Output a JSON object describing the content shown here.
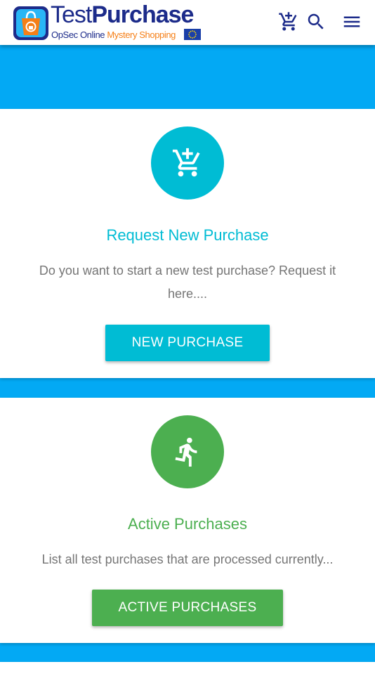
{
  "header": {
    "logo_title_thin": "Test",
    "logo_title_bold": "Purchase",
    "logo_sub_a": "OpSec Online ",
    "logo_sub_b": "Mystery Shopping",
    "icons": [
      "add-cart-icon",
      "search-icon",
      "menu-icon"
    ]
  },
  "cards": [
    {
      "icon": "add-shopping-cart-icon",
      "title": "Request New Purchase",
      "description": "Do you want to start a new test purchase? Request it here....",
      "button_label": "NEW PURCHASE",
      "color": "#00bcd4"
    },
    {
      "icon": "running-person-icon",
      "title": "Active Purchases",
      "description": "List all test purchases that are processed currently...",
      "button_label": "ACTIVE PURCHASES",
      "color": "#4caf50"
    }
  ],
  "colors": {
    "background": "#03a9f4",
    "brand_navy": "#1c2b8a",
    "brand_orange": "#f57f17",
    "text_gray": "#757575"
  }
}
